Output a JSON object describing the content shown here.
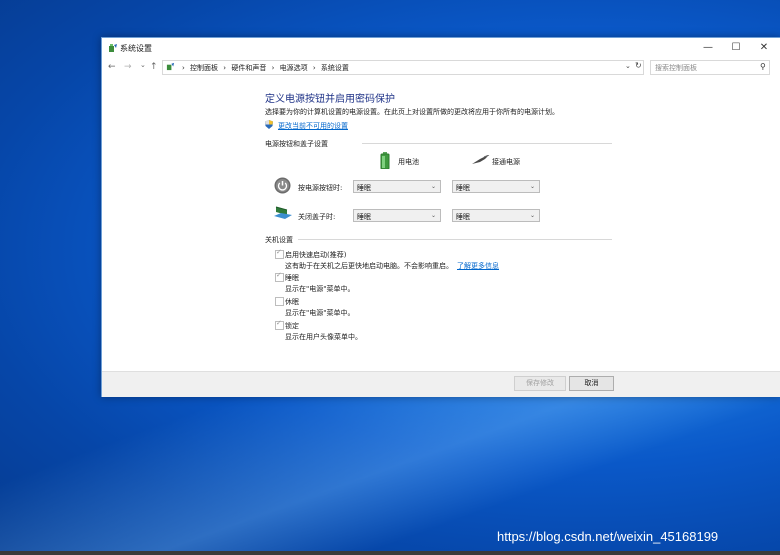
{
  "window": {
    "title": "系统设置",
    "controls": {
      "minimize": "—",
      "maximize": "☐",
      "close": "✕"
    }
  },
  "address_bar": {
    "back": "←",
    "forward": "→",
    "recent": "⌄",
    "up": "↑",
    "breadcrumbs": [
      "控制面板",
      "硬件和声音",
      "电源选项",
      "系统设置"
    ],
    "separator": "›",
    "search_placeholder": "搜索控制面板"
  },
  "page": {
    "title": "定义电源按钮并启用密码保护",
    "description": "选择要为你的计算机设置的电源设置。在此页上对设置所做的更改将应用于你所有的电源计划。",
    "change_link": "更改当前不可用的设置"
  },
  "power_section": {
    "heading": "电源按钮和盖子设置",
    "columns": {
      "battery": "用电池",
      "plugged_in": "接通电源"
    },
    "rows": [
      {
        "label": "按电源按钮时:",
        "battery": "睡眠",
        "plugged_in": "睡眠"
      },
      {
        "label": "关闭盖子时:",
        "battery": "睡眠",
        "plugged_in": "睡眠"
      }
    ]
  },
  "shutdown_section": {
    "heading": "关机设置",
    "options": [
      {
        "label": "启用快速启动(推荐)",
        "desc": "这有助于在关机之后更快地启动电脑。不会影响重启。",
        "link": "了解更多信息",
        "checked": true
      },
      {
        "label": "睡眠",
        "desc": "显示在\"电源\"菜单中。",
        "checked": true
      },
      {
        "label": "休眠",
        "desc": "显示在\"电源\"菜单中。",
        "checked": false
      },
      {
        "label": "锁定",
        "desc": "显示在用户头像菜单中。",
        "checked": true
      }
    ]
  },
  "footer": {
    "save": "保存修改",
    "cancel": "取消"
  },
  "watermark": "https://blog.csdn.net/weixin_45168199"
}
